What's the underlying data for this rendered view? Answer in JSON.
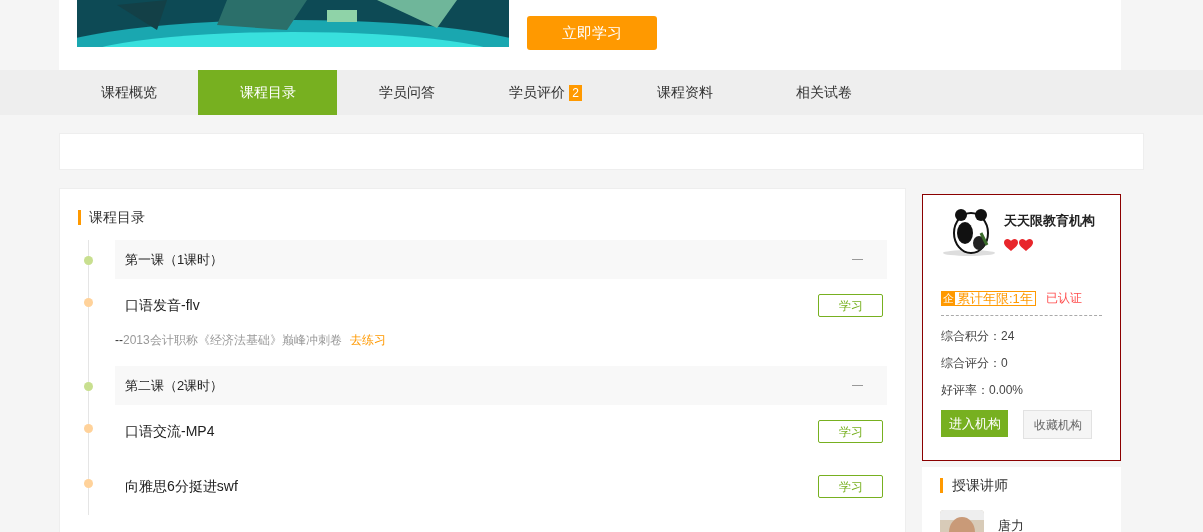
{
  "course": {
    "start_button": "立即学习"
  },
  "tabs": [
    {
      "label": "课程概览",
      "selected": false
    },
    {
      "label": "课程目录",
      "selected": true
    },
    {
      "label": "学员问答",
      "selected": false
    },
    {
      "label": "学员评价",
      "selected": false,
      "badge": "2"
    },
    {
      "label": "课程资料",
      "selected": false
    },
    {
      "label": "相关试卷",
      "selected": false
    }
  ],
  "catalog": {
    "title": "课程目录",
    "lessons": [
      {
        "title": "第一课（1课时）",
        "expanded": true,
        "items": [
          {
            "name": "口语发音-flv",
            "button": "学习",
            "exercise": {
              "prefix": "--",
              "text": "2013会计职称《经济法基础》巅峰冲刺卷",
              "link": "去练习"
            }
          }
        ]
      },
      {
        "title": "第二课（2课时）",
        "expanded": true,
        "items": [
          {
            "name": "口语交流-MP4",
            "button": "学习"
          },
          {
            "name": "向雅思6分挺进swf",
            "button": "学习"
          }
        ]
      }
    ]
  },
  "institution": {
    "name": "天天限教育机构",
    "rating_icons": [
      {
        "kind": "heart"
      },
      {
        "kind": "heart"
      }
    ],
    "years_icon": "企",
    "years": "累计年限:1年",
    "verified": "已认证",
    "stats": [
      "综合积分：24",
      "综合评分：0",
      "好评率：0.00%"
    ],
    "enter_button": "进入机构",
    "favorite_button": "收藏机构"
  },
  "teachers": {
    "title": "授课讲师",
    "items": [
      {
        "name": "唐力"
      }
    ]
  }
}
